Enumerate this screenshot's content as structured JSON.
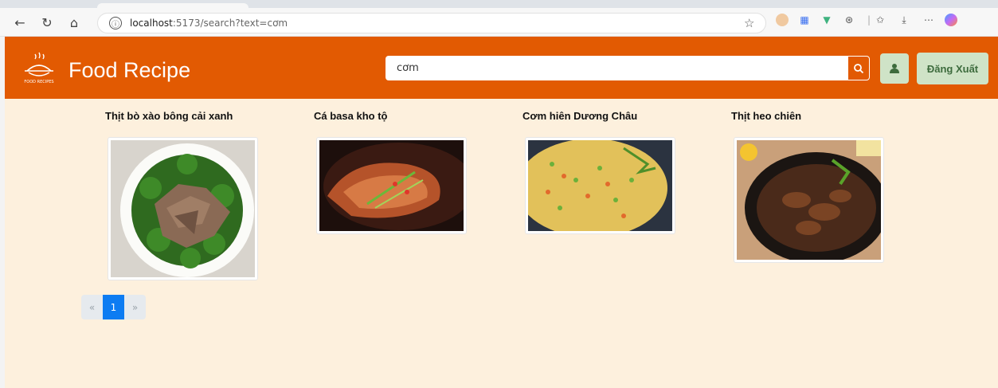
{
  "browser": {
    "url_host": "localhost",
    "url_rest": ":5173/search?text=cơm",
    "info_icon": "ⓘ"
  },
  "header": {
    "brand": "Food Recipe",
    "logo_text": "FOOD RECIPES",
    "search_value": "cơm",
    "logout_label": "Đăng Xuất"
  },
  "recipes": [
    {
      "title": "Thịt bò xào bông cải xanh"
    },
    {
      "title": "Cá basa kho tộ"
    },
    {
      "title": "Cơm hiên Dương Châu"
    },
    {
      "title": "Thịt heo chiên"
    }
  ],
  "pagination": {
    "prev": "«",
    "current": "1",
    "next": "»"
  },
  "colors": {
    "header": "#e25a02",
    "page_bg": "#fdf0dd",
    "logout_bg": "#cfe3c7",
    "active_page": "#0d7cf2"
  }
}
